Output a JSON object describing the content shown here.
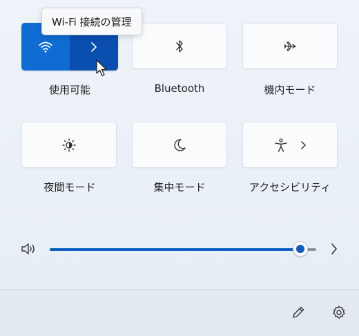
{
  "tooltip": {
    "text": "Wi-Fi 接続の管理"
  },
  "tiles": {
    "wifi": {
      "label": "使用可能"
    },
    "bluetooth": {
      "label": "Bluetooth"
    },
    "airplane": {
      "label": "機内モード"
    },
    "night_light": {
      "label": "夜間モード"
    },
    "focus": {
      "label": "集中モード"
    },
    "accessibility": {
      "label": "アクセシビリティ"
    }
  },
  "volume": {
    "level": 0.94
  },
  "colors": {
    "accent": "#0f6cd3",
    "accent_dark": "#0a4fb0"
  },
  "icons": {
    "wifi": "wifi-icon",
    "wifi_chevron": "chevron-right-icon",
    "bluetooth": "bluetooth-icon",
    "airplane": "airplane-icon",
    "night_light": "brightness-icon",
    "focus": "moon-icon",
    "accessibility": "accessibility-icon",
    "volume": "speaker-icon",
    "edit": "pencil-icon",
    "settings": "gear-icon"
  }
}
